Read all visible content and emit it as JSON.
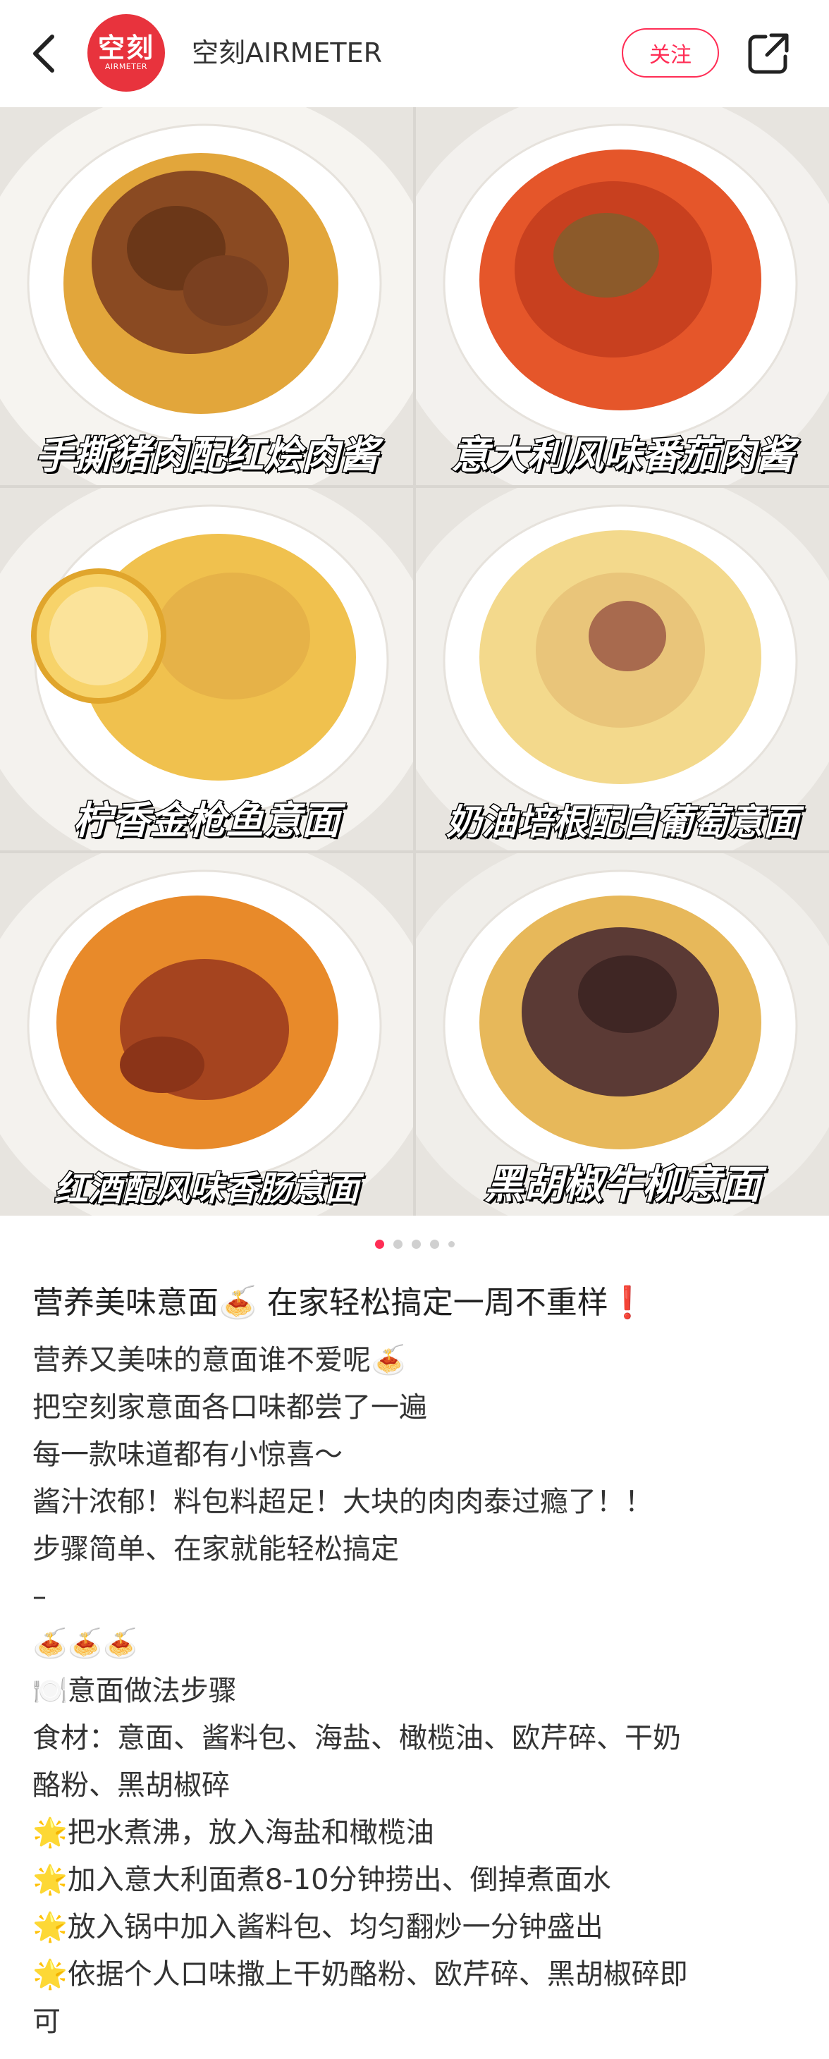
{
  "header": {
    "avatar_line1": "空刻",
    "avatar_line2": "AIRMETER",
    "author_name": "空刻AIRMETER",
    "follow_label": "关注"
  },
  "gallery": {
    "captions": [
      "手撕猪肉配红烩肉酱",
      "意大利风味番茄肉酱",
      "柠香金枪鱼意面",
      "奶油培根配白葡萄意面",
      "红酒配风味香肠意面",
      "黑胡椒牛柳意面"
    ],
    "dot_count": 5,
    "active_dot": 0
  },
  "post": {
    "title": "营养美味意面🍝 在家轻松搞定一周不重样❗",
    "lines": [
      "营养又美味的意面谁不爱呢🍝",
      "把空刻家意面各口味都尝了一遍",
      "每一款味道都有小惊喜～",
      "酱汁浓郁！料包料超足！大块的肉肉泰过瘾了！！",
      "步骤简单、在家就能轻松搞定",
      "–",
      "🍝🍝🍝",
      "🍽️意面做法步骤",
      "食材：意面、酱料包、海盐、橄榄油、欧芹碎、干奶",
      "酪粉、黑胡椒碎",
      "🌟把水煮沸，放入海盐和橄榄油",
      "🌟加入意大利面煮8-10分钟捞出、倒掉煮面水",
      "🌟放入锅中加入酱料包、均匀翻炒一分钟盛出",
      "🌟依据个人口味撒上干奶酪粉、欧芹碎、黑胡椒碎即",
      "可"
    ]
  },
  "colors": {
    "accent": "#ff2d55",
    "brand": "#e8333d"
  }
}
